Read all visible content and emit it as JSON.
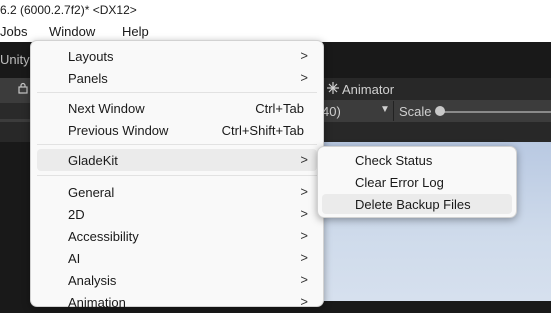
{
  "window": {
    "title": "6.2 (6000.2.7f2)* <DX12>"
  },
  "menubar": {
    "items": [
      "Jobs",
      "Window",
      "Help"
    ]
  },
  "editor": {
    "unity_label": "Unity",
    "animator_label": "Animator",
    "resolution_text": "40)",
    "scale_label": "Scale"
  },
  "window_menu": {
    "items": [
      {
        "label": "Layouts",
        "shortcut": "",
        "submenu": true
      },
      {
        "label": "Panels",
        "shortcut": "",
        "submenu": true
      },
      {
        "label": "Next Window",
        "shortcut": "Ctrl+Tab",
        "submenu": false
      },
      {
        "label": "Previous Window",
        "shortcut": "Ctrl+Shift+Tab",
        "submenu": false
      },
      {
        "label": "GladeKit",
        "shortcut": "",
        "submenu": true,
        "highlighted": true
      },
      {
        "label": "General",
        "shortcut": "",
        "submenu": true
      },
      {
        "label": "2D",
        "shortcut": "",
        "submenu": true
      },
      {
        "label": "Accessibility",
        "shortcut": "",
        "submenu": true
      },
      {
        "label": "AI",
        "shortcut": "",
        "submenu": true
      },
      {
        "label": "Analysis",
        "shortcut": "",
        "submenu": true
      },
      {
        "label": "Animation",
        "shortcut": "",
        "submenu": true
      }
    ],
    "submenu_arrow": ">"
  },
  "gladekit_submenu": {
    "items": [
      {
        "label": "Check Status"
      },
      {
        "label": "Clear Error Log"
      },
      {
        "label": "Delete Backup Files",
        "highlighted": true
      }
    ]
  },
  "colors": {
    "menu_bg": "#f9f9f9",
    "highlight": "#ebebeb",
    "editor_dark": "#191919"
  }
}
